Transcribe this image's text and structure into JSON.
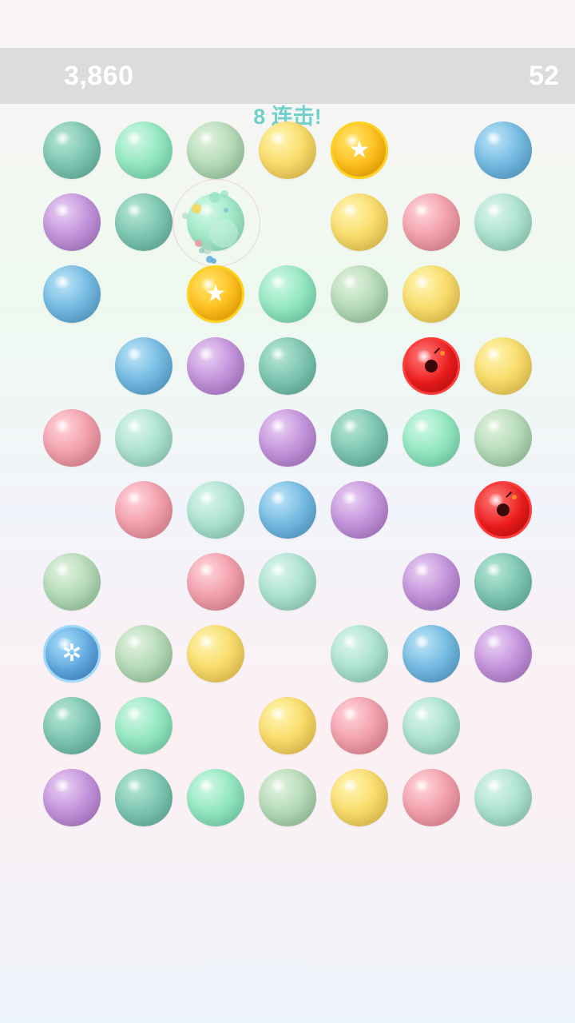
{
  "hud": {
    "score": "3,860",
    "time_left": "52"
  },
  "combo_text": "8 连击!",
  "colors": {
    "teal": "#80c8b4",
    "mint": "#96e8c3",
    "sage": "#b7dcb9",
    "aqua": "#aee3d1",
    "yellow": "#f9dd6c",
    "blue": "#78bde3",
    "purple": "#c696dd",
    "pink": "#f3a2ae"
  },
  "board": {
    "columns": 7,
    "rows": 10,
    "legend": {
      "T": "teal",
      "M": "mint",
      "S": "sage",
      "A": "aqua",
      "Y": "yellow",
      "B": "blue",
      "P": "purple",
      "K": "pink",
      "*": "star-powerup",
      "X": "bomb-powerup",
      "I": "ice-powerup",
      ".": "empty",
      "o": "popping-bubble"
    },
    "grid": [
      [
        "T",
        "M",
        "S",
        "Y",
        "*",
        ".",
        "B"
      ],
      [
        "P",
        "T",
        "o",
        ".",
        "Y",
        "K",
        "A"
      ],
      [
        "B",
        ".",
        "*",
        "M",
        "S",
        "Y",
        "."
      ],
      [
        ".",
        "B",
        "P",
        "T",
        ".",
        "X",
        "Y"
      ],
      [
        "K",
        "A",
        ".",
        "P",
        "T",
        "M",
        "S"
      ],
      [
        ".",
        "K",
        "A",
        "B",
        "P",
        ".",
        "X"
      ],
      [
        "S",
        ".",
        "K",
        "A",
        ".",
        "P",
        "T"
      ],
      [
        "I",
        "S",
        "Y",
        ".",
        "A",
        "B",
        "P"
      ],
      [
        "T",
        "M",
        ".",
        "Y",
        "K",
        "A",
        "."
      ],
      [
        "P",
        "T",
        "M",
        "S",
        "Y",
        "K",
        "A"
      ]
    ]
  },
  "icons": {
    "star": "star-icon",
    "bomb": "bomb-icon",
    "ice": "snowflake-icon"
  }
}
